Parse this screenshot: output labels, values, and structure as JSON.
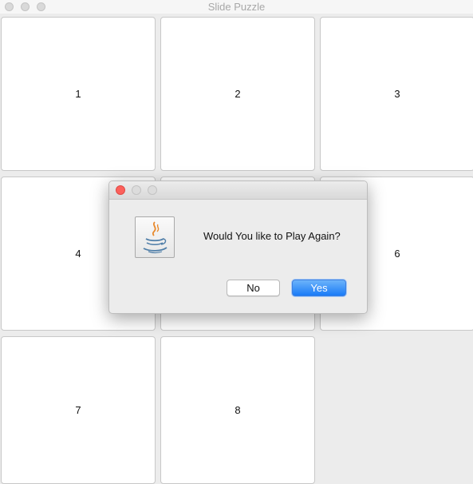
{
  "window": {
    "title": "Slide Puzzle"
  },
  "tiles": [
    "1",
    "2",
    "3",
    "4",
    "",
    "6",
    "7",
    "8"
  ],
  "dialog": {
    "message": "Would You like to Play Again?",
    "no_label": "No",
    "yes_label": "Yes",
    "icon": "java-coffee-cup-icon",
    "accent": "#1a7bf7"
  }
}
